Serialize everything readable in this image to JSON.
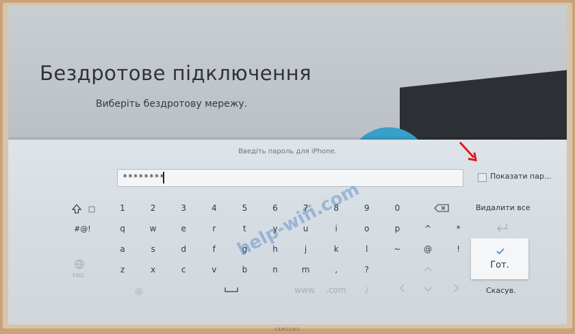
{
  "header": {
    "title": "Бездротове підключення",
    "subtitle": "Виберіть бездротову мережу."
  },
  "dialog": {
    "prompt": "Введіть пароль для iPhone.",
    "password_value": "********",
    "show_password_label": "Показати пар...",
    "show_password_checked": false
  },
  "keyboard": {
    "row1": [
      "1",
      "2",
      "3",
      "4",
      "5",
      "6",
      "7",
      "8",
      "9",
      "0"
    ],
    "row2": [
      "q",
      "w",
      "e",
      "r",
      "t",
      "y",
      "u",
      "i",
      "o",
      "p",
      "^",
      "*"
    ],
    "row3": [
      "a",
      "s",
      "d",
      "f",
      "g",
      "h",
      "j",
      "k",
      "l",
      "~",
      "@",
      "!"
    ],
    "row4": [
      "z",
      "x",
      "c",
      "v",
      "b",
      "n",
      "m",
      ",",
      "?"
    ],
    "row5": [
      "www.",
      ".com",
      "/"
    ],
    "shift_mode": "#@!",
    "lang_key": "ENG",
    "delete_all": "Видалити все",
    "done": "Гот.",
    "cancel": "Скасув."
  },
  "watermark": "help-wifi.com",
  "brand": "SAMSUNG",
  "colors": {
    "accent": "#3a7bd5",
    "arrow": "#e0191b"
  }
}
